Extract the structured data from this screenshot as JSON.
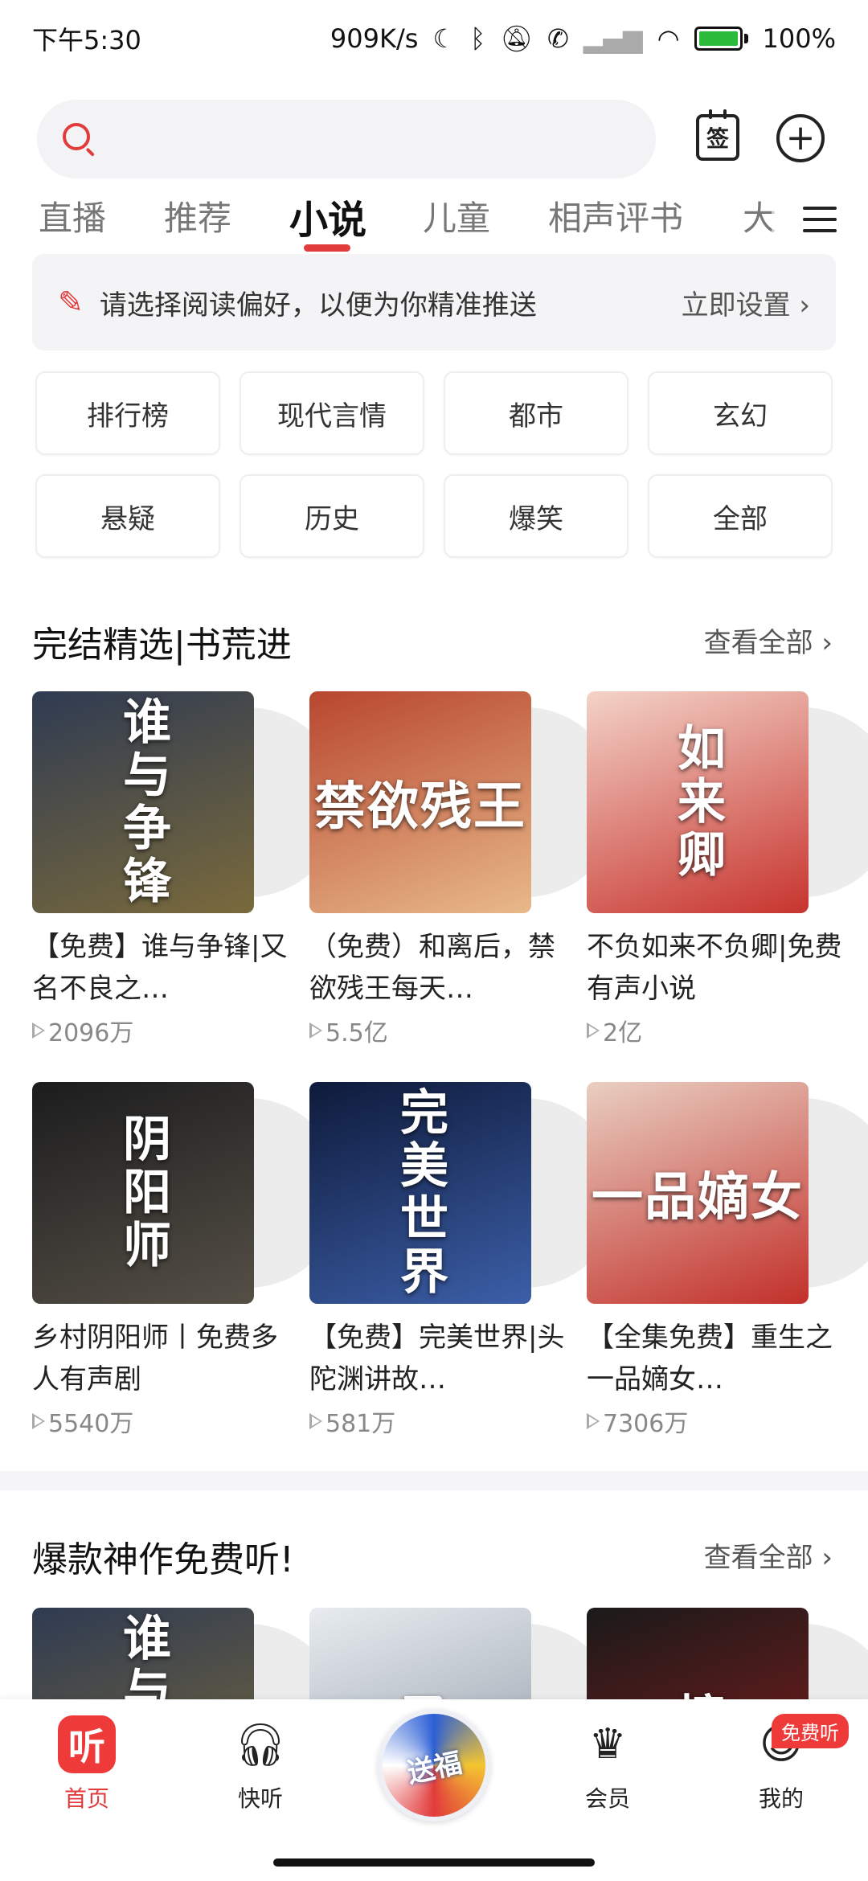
{
  "status_bar": {
    "time": "下午5:30",
    "net_speed": "909K/s",
    "battery": "100%",
    "icons": [
      "moon-icon",
      "bluetooth-icon",
      "mute-icon",
      "no-call-icon",
      "signal-icon",
      "wifi-icon",
      "battery-icon"
    ]
  },
  "header": {
    "search_placeholder": "",
    "sign_label": "签"
  },
  "tabs": [
    {
      "label": "直播"
    },
    {
      "label": "推荐"
    },
    {
      "label": "小说",
      "active": true
    },
    {
      "label": "儿童"
    },
    {
      "label": "相声评书"
    },
    {
      "label": "大"
    }
  ],
  "preference": {
    "text": "请选择阅读偏好，以便为你精准推送",
    "link": "立即设置 ›"
  },
  "categories": [
    "排行榜",
    "现代言情",
    "都市",
    "玄幻",
    "悬疑",
    "历史",
    "爆笑",
    "全部"
  ],
  "section1": {
    "title": "完结精选|书荒进",
    "more": "查看全部 ›",
    "books": [
      {
        "name": "【免费】谁与争锋|又名不良之…",
        "plays": "2096万",
        "cover_title": "谁与争锋",
        "cover_colors": [
          "#2f3b52",
          "#7a6a3c"
        ]
      },
      {
        "name": "（免费）和离后，禁欲残王每天…",
        "plays": "5.5亿",
        "cover_title": "禁欲残王",
        "cover_colors": [
          "#b8462f",
          "#e8b98a"
        ]
      },
      {
        "name": "不负如来不负卿|免费有声小说",
        "plays": "2亿",
        "cover_title": "如来卿",
        "cover_colors": [
          "#f3d3c8",
          "#c7342e"
        ]
      },
      {
        "name": "乡村阴阳师丨免费多人有声剧",
        "plays": "5540万",
        "cover_title": "阴阳师",
        "cover_colors": [
          "#1c1c1e",
          "#555046"
        ]
      },
      {
        "name": "【免费】完美世界|头陀渊讲故…",
        "plays": "581万",
        "cover_title": "完美世界",
        "cover_colors": [
          "#0e1a3a",
          "#3c5fa8"
        ]
      },
      {
        "name": "【全集免费】重生之一品嫡女…",
        "plays": "7306万",
        "cover_title": "一品嫡女",
        "cover_colors": [
          "#e9cfc2",
          "#c2302a"
        ]
      }
    ]
  },
  "section2": {
    "title": "爆款神作免费听!",
    "more": "查看全部 ›",
    "covers": [
      {
        "cover_title": "谁与争锋",
        "cover_colors": [
          "#2f3b52",
          "#7a6a3c"
        ]
      },
      {
        "cover_title": "圣",
        "cover_colors": [
          "#e8ecf0",
          "#8c96a3"
        ]
      },
      {
        "cover_title": "撞",
        "cover_colors": [
          "#1a1a1a",
          "#8a1c1c"
        ]
      }
    ]
  },
  "bottom_nav": {
    "items": [
      {
        "label": "首页",
        "icon": "ting-icon",
        "active": true
      },
      {
        "label": "快听",
        "icon": "headphone-icon"
      },
      {
        "label": "会员",
        "icon": "crown-icon"
      },
      {
        "label": "我的",
        "icon": "user-icon"
      }
    ],
    "center_disc": "送福",
    "badge": "免费听"
  }
}
